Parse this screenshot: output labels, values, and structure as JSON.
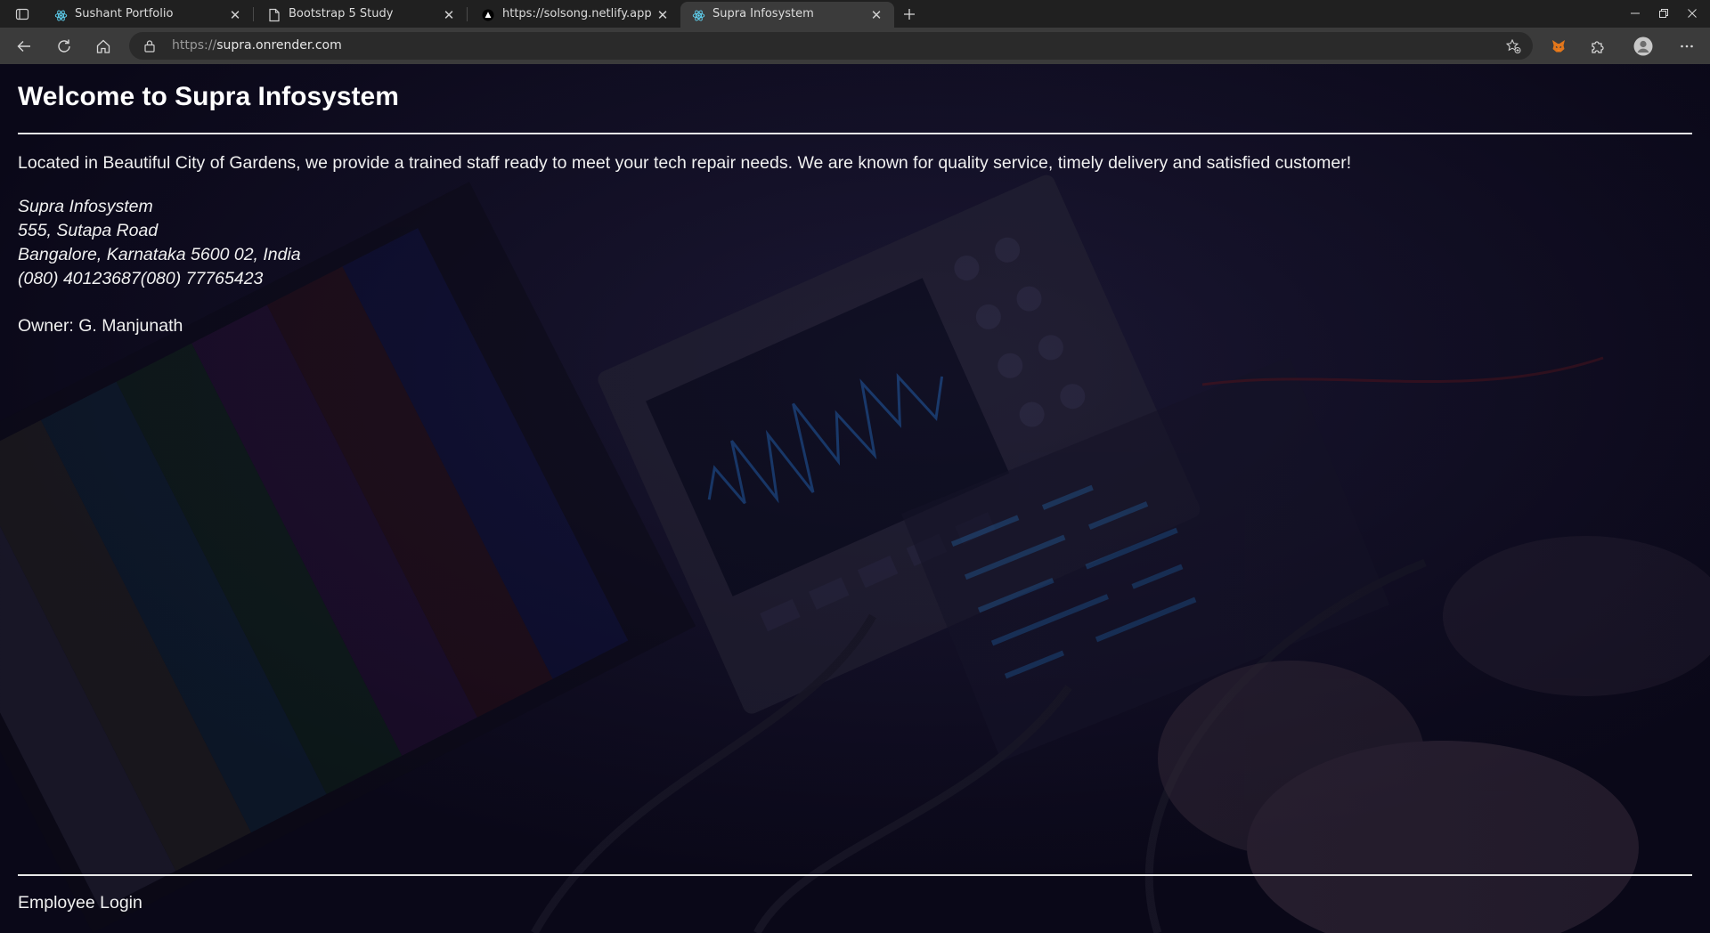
{
  "browser": {
    "tabs": [
      {
        "title": "Sushant Portfolio",
        "icon": "react-icon"
      },
      {
        "title": "Bootstrap 5 Study",
        "icon": "page-icon"
      },
      {
        "title": "https://solsong.netlify.app",
        "icon": "netlify-triangle-icon"
      },
      {
        "title": "Supra Infosystem",
        "icon": "react-icon",
        "active": true
      }
    ],
    "address_bar": {
      "protocol": "https://",
      "host": "supra.onrender.com"
    }
  },
  "page": {
    "headline": "Welcome to Supra Infosystem",
    "intro": "Located in Beautiful City of Gardens, we provide a trained staff ready to meet your tech repair needs. We are known for quality service, timely delivery and satisfied customer!",
    "address_lines": [
      "Supra Infosystem",
      "555, Sutapa Road",
      "Bangalore, Karnataka 5600 02, India",
      "(080) 40123687(080) 77765423"
    ],
    "owner": "Owner: G. Manjunath",
    "footer_link": "Employee Login"
  },
  "colors": {
    "tabstrip_bg": "#202020",
    "toolbar_bg": "#3b3b3b",
    "page_bg": "#0a0818",
    "text": "#f2f2f2"
  }
}
